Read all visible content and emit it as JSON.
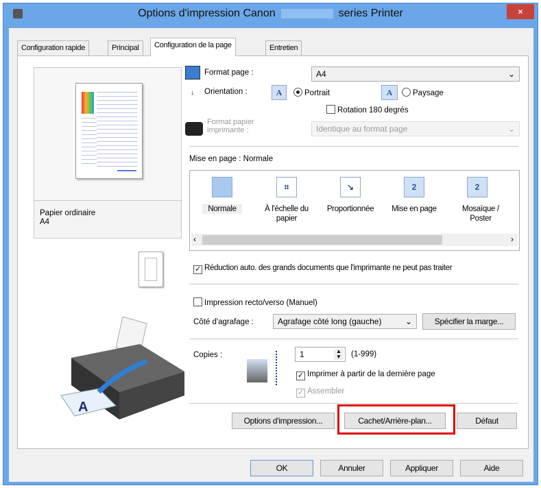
{
  "window": {
    "title_left": "Options d'impression Canon",
    "title_right": "series Printer",
    "close": "×"
  },
  "tabs": [
    {
      "label": "Configuration rapide"
    },
    {
      "label": "Principal"
    },
    {
      "label": "Configuration de la page"
    },
    {
      "label": "Entretien"
    }
  ],
  "preview": {
    "media": "Papier ordinaire",
    "size": "A4"
  },
  "page_size": {
    "label": "Format page :",
    "value": "A4"
  },
  "orientation": {
    "label": "Orientation :",
    "portrait": "Portrait",
    "landscape": "Paysage",
    "selected": "Portrait",
    "rotate": "Rotation 180 degrés",
    "rotate_checked": false
  },
  "printer_paper": {
    "label_line1": "Format papier",
    "label_line2": "imprimante :",
    "value": "Identique au format page"
  },
  "layout": {
    "label": "Mise en page :",
    "value": "Normale",
    "options": [
      {
        "label": "Normale",
        "icon": "normal"
      },
      {
        "label": "À l'échelle du papier",
        "icon": "fit"
      },
      {
        "label": "Proportionnée",
        "icon": "scaled"
      },
      {
        "label": "Mise en page",
        "icon": "page-layout",
        "num": "2"
      },
      {
        "label": "Mosaïque / Poster",
        "icon": "tiling",
        "num": "2"
      }
    ]
  },
  "auto_reduce": {
    "label": "Réduction auto. des grands documents que l'imprimante ne peut pas traiter",
    "checked": true
  },
  "duplex": {
    "label": "Impression recto/verso (Manuel)",
    "checked": false
  },
  "stapling": {
    "label": "Côté d'agrafage :",
    "value": "Agrafage côté long (gauche)",
    "margin_button": "Spécifier la marge..."
  },
  "copies": {
    "label": "Copies :",
    "value": "1",
    "range": "(1-999)",
    "reverse": "Imprimer à partir de la dernière page",
    "reverse_checked": true,
    "collate": "Assembler",
    "collate_checked": true
  },
  "buttons": {
    "print_options": "Options d'impression...",
    "stamp": "Cachet/Arrière-plan...",
    "defaults": "Défaut",
    "ok": "OK",
    "cancel": "Annuler",
    "apply": "Appliquer",
    "help": "Aide"
  },
  "colors": {
    "titlebar": "#6ba6e8",
    "highlight": "#e00000",
    "close": "#c7423a"
  }
}
